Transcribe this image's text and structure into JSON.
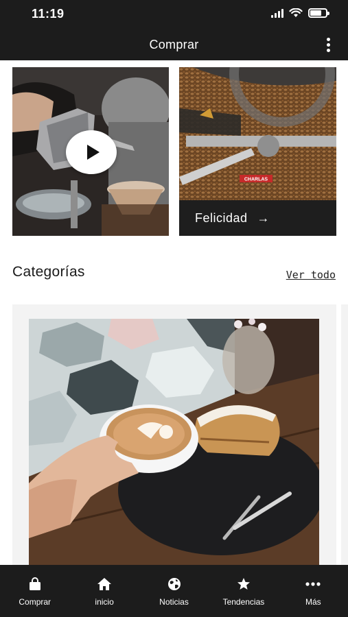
{
  "status_bar": {
    "time": "11:19",
    "battery_level": 0.75
  },
  "header": {
    "title": "Comprar"
  },
  "promo_card": {
    "label": "Felicidad",
    "arrow": "→",
    "brand_tag": "CHARLAS"
  },
  "section": {
    "title": "Categorías",
    "see_all": "Ver todo"
  },
  "bottom_nav": [
    {
      "label": "Comprar",
      "icon": "shopping-bag-icon"
    },
    {
      "label": "inicio",
      "icon": "home-icon"
    },
    {
      "label": "Noticias",
      "icon": "globe-icon"
    },
    {
      "label": "Tendencias",
      "icon": "star-icon"
    },
    {
      "label": "Más",
      "icon": "more-dots-icon"
    }
  ],
  "colors": {
    "bar_background": "#1c1c1c",
    "card_background": "#f3f3f3",
    "text": "#1a1a1a"
  }
}
